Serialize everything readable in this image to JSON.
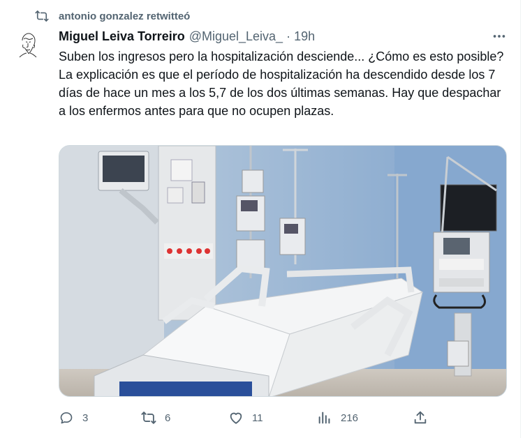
{
  "retweet": {
    "text": "antonio gonzalez retwitteó",
    "icon": "retweet-icon"
  },
  "tweet": {
    "author_name": "Miguel Leiva Torreiro",
    "author_handle": "@Miguel_Leiva_",
    "separator": "·",
    "time": "19h",
    "text_lines": [
      "Suben los ingresos pero la hospitalización desciende... ¿Cómo es esto posible?",
      "La explicación es que el período de hospitalización ha descendido desde los 7 días de hace un mes a los 5,7 de los dos últimas semanas. Hay que despachar a los enfermos antes para que no ocupen plazas."
    ],
    "media_icon": "hospital-bed-photo"
  },
  "actions": {
    "reply_count": "3",
    "retweet_count": "6",
    "like_count": "11",
    "views_count": "216"
  },
  "colors": {
    "text": "#0f1419",
    "secondary": "#536471",
    "border": "#cfd9de"
  }
}
